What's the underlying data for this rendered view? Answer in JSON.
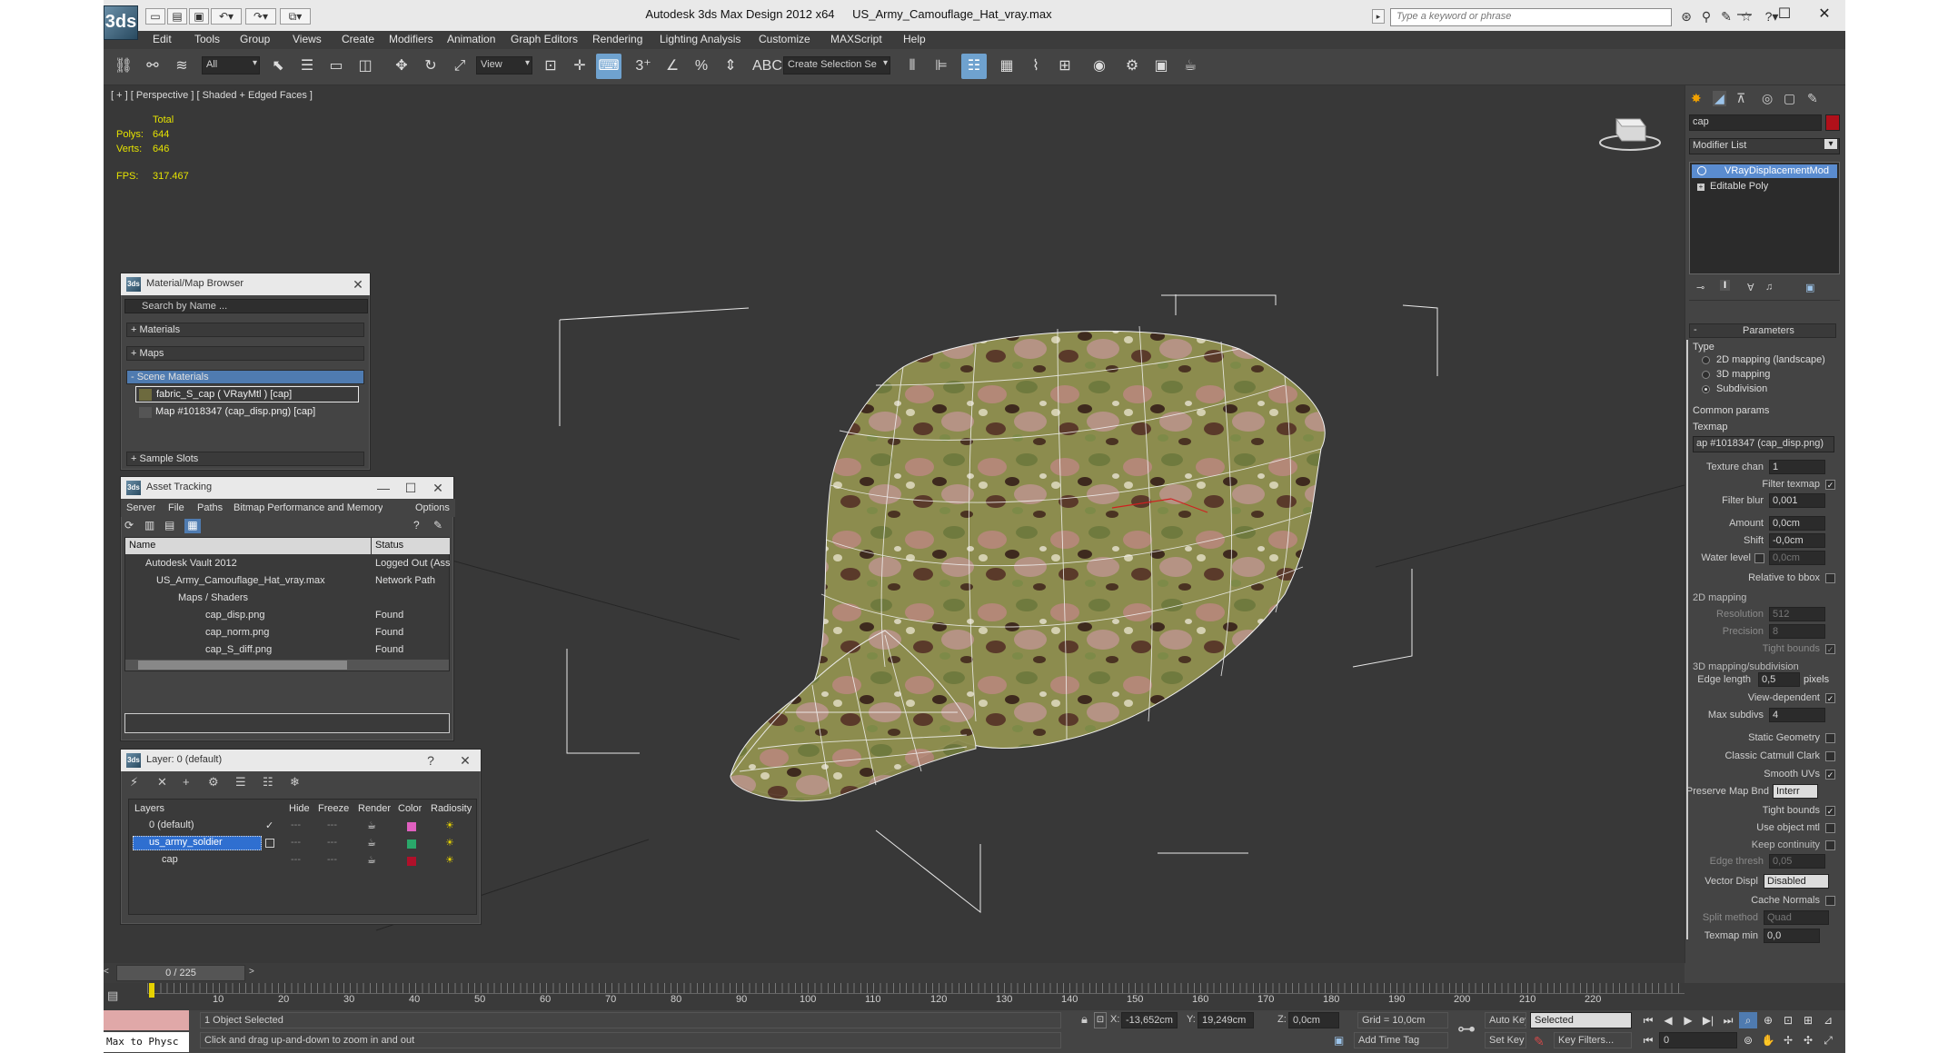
{
  "app": {
    "logo": "3ds",
    "title_app": "Autodesk 3ds Max Design 2012 x64",
    "title_file": "US_Army_Camouflage_Hat_vray.max",
    "search_placeholder": "Type a keyword or phrase",
    "win_min": "—",
    "win_max": "☐",
    "win_close": "✕"
  },
  "menu": [
    "Edit",
    "Tools",
    "Group",
    "Views",
    "Create",
    "Modifiers",
    "Animation",
    "Graph Editors",
    "Rendering",
    "Lighting Analysis",
    "Customize",
    "MAXScript",
    "Help"
  ],
  "toolbar": {
    "filter": "All",
    "refcoord": "View",
    "selection_set": "Create Selection Se"
  },
  "viewport": {
    "label": "[ + ] [ Perspective ] [ Shaded + Edged Faces ]",
    "stats": {
      "total_label": "Total",
      "polys_label": "Polys:",
      "polys": "644",
      "verts_label": "Verts:",
      "verts": "646",
      "fps_label": "FPS:",
      "fps": "317.467"
    }
  },
  "material_browser": {
    "title": "Material/Map Browser",
    "search": "Search by Name ...",
    "materials": "+ Materials",
    "maps": "+ Maps",
    "scene_materials": "- Scene Materials",
    "item1": "fabric_S_cap  ( VRayMtl )  [cap]",
    "item2": "Map #1018347 (cap_disp.png)  [cap]",
    "sample_slots": "+ Sample Slots"
  },
  "asset_tracking": {
    "title": "Asset Tracking",
    "menu": [
      "Server",
      "File",
      "Paths",
      "Bitmap Performance and Memory",
      "Options"
    ],
    "col_name": "Name",
    "col_status": "Status",
    "rows": [
      {
        "name": "Autodesk Vault 2012",
        "status": "Logged Out (Asse"
      },
      {
        "name": "US_Army_Camouflage_Hat_vray.max",
        "status": "Network Path"
      },
      {
        "name": "Maps / Shaders",
        "status": ""
      },
      {
        "name": "cap_disp.png",
        "status": "Found"
      },
      {
        "name": "cap_norm.png",
        "status": "Found"
      },
      {
        "name": "cap_S_diff.png",
        "status": "Found"
      }
    ]
  },
  "layer_panel": {
    "title": "Layer: 0 (default)",
    "help": "?",
    "cols": [
      "Layers",
      "Hide",
      "Freeze",
      "Render",
      "Color",
      "Radiosity"
    ],
    "rows": [
      {
        "name": "0 (default)",
        "color": "#e060c0"
      },
      {
        "name": "us_army_soldier",
        "color": "#2aa86a"
      },
      {
        "name": "cap",
        "color": "#b0102a"
      }
    ]
  },
  "command_panel": {
    "object_name": "cap",
    "object_color": "#b0101a",
    "modifier_list": "Modifier List",
    "stack": [
      "VRayDisplacementMod",
      "Editable Poly"
    ],
    "rollout_title": "Parameters",
    "type_label": "Type",
    "type_options": [
      "2D mapping (landscape)",
      "3D mapping",
      "Subdivision"
    ],
    "common_params": "Common params",
    "texmap_label": "Texmap",
    "texmap_value": "ap #1018347 (cap_disp.png)",
    "texture_chan_label": "Texture chan",
    "texture_chan": "1",
    "filter_texmap_label": "Filter texmap",
    "filter_blur_label": "Filter blur",
    "filter_blur": "0,001",
    "amount_label": "Amount",
    "amount": "0,0cm",
    "shift_label": "Shift",
    "shift": "-0,0cm",
    "water_label": "Water level",
    "water": "0,0cm",
    "relative_label": "Relative to bbox",
    "section_2d": "2D mapping",
    "resolution_label": "Resolution",
    "resolution": "512",
    "precision_label": "Precision",
    "precision": "8",
    "tight_label": "Tight bounds",
    "section_3d": "3D mapping/subdivision",
    "edge_length_label": "Edge length",
    "edge_length": "0,5",
    "pixels": "pixels",
    "view_dep_label": "View-dependent",
    "max_subdivs_label": "Max subdivs",
    "max_subdivs": "4",
    "static_geo_label": "Static Geometry",
    "catmull_label": "Classic Catmull Clark",
    "smooth_uv_label": "Smooth UVs",
    "preserve_label": "Preserve Map Bnd",
    "preserve_value": "Interr",
    "tight2_label": "Tight bounds",
    "use_obj_label": "Use object mtl",
    "keep_cont_label": "Keep continuity",
    "edge_thresh_label": "Edge thresh",
    "edge_thresh": "0,05",
    "vector_label": "Vector Displ",
    "vector_value": "Disabled",
    "cache_label": "Cache Normals",
    "split_label": "Split method",
    "split_value": "Quad",
    "texmap_min_label": "Texmap min",
    "texmap_min": "0,0"
  },
  "timeline": {
    "frame": "0 / 225",
    "ticks": [
      "10",
      "20",
      "30",
      "40",
      "50",
      "60",
      "70",
      "80",
      "90",
      "100",
      "110",
      "120",
      "130",
      "140",
      "150",
      "160",
      "170",
      "180",
      "190",
      "200",
      "210",
      "220"
    ]
  },
  "status": {
    "maxscript": "Max to Physc",
    "selected": "1 Object Selected",
    "prompt": "Click and drag up-and-down to zoom in and out",
    "x_label": "X:",
    "x": "-13,652cm",
    "y_label": "Y:",
    "y": "19,249cm",
    "z_label": "Z:",
    "z": "0,0cm",
    "grid": "Grid = 10,0cm",
    "add_time_tag": "Add Time Tag",
    "auto_key": "Auto Key",
    "set_key": "Set Key",
    "selected_dd": "Selected",
    "key_filters": "Key Filters...",
    "frame_field": "0"
  }
}
